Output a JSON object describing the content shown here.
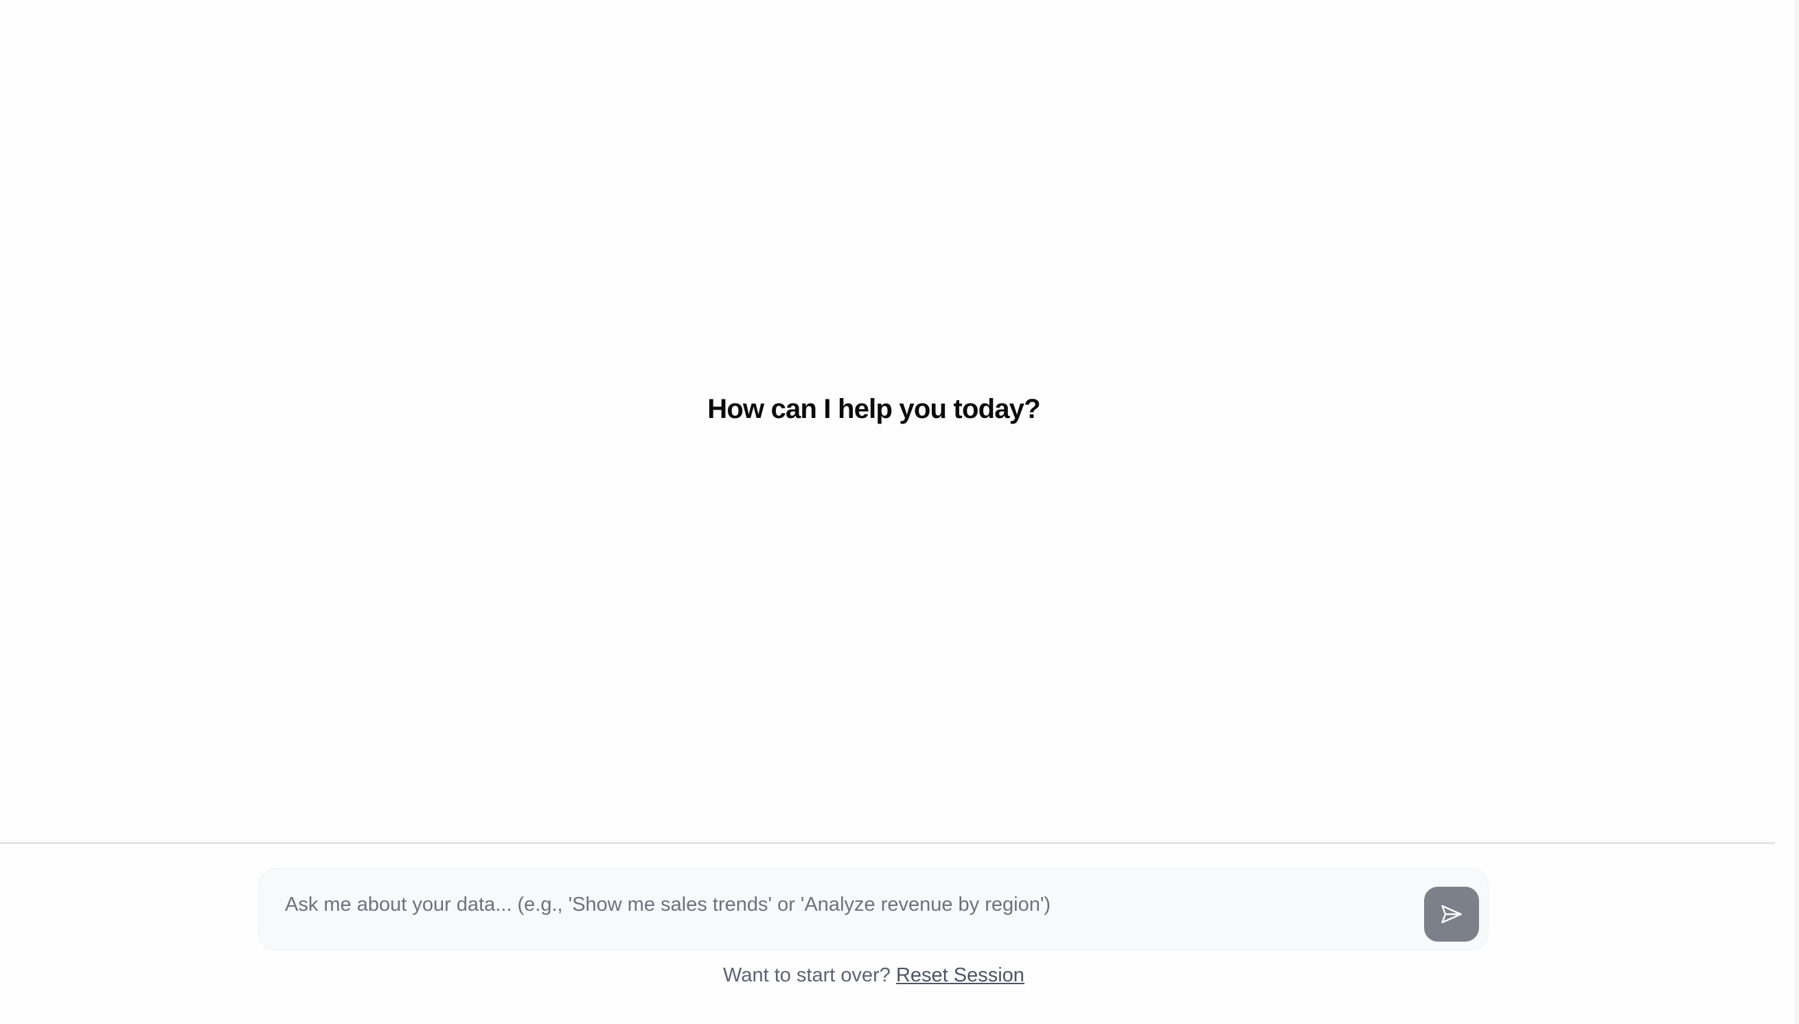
{
  "welcome": {
    "title": "How can I help you today?"
  },
  "composer": {
    "placeholder": "Ask me about your data... (e.g., 'Show me sales trends' or 'Analyze revenue by region')",
    "value": "",
    "send_icon": "send-arrow-icon"
  },
  "footer": {
    "prompt": "Want to start over?",
    "reset_label": "Reset Session"
  },
  "colors": {
    "background": "#fefefe",
    "send_button": "#7c8088",
    "composer_bg": "#f8f9fa",
    "muted_text": "#5b6474"
  }
}
